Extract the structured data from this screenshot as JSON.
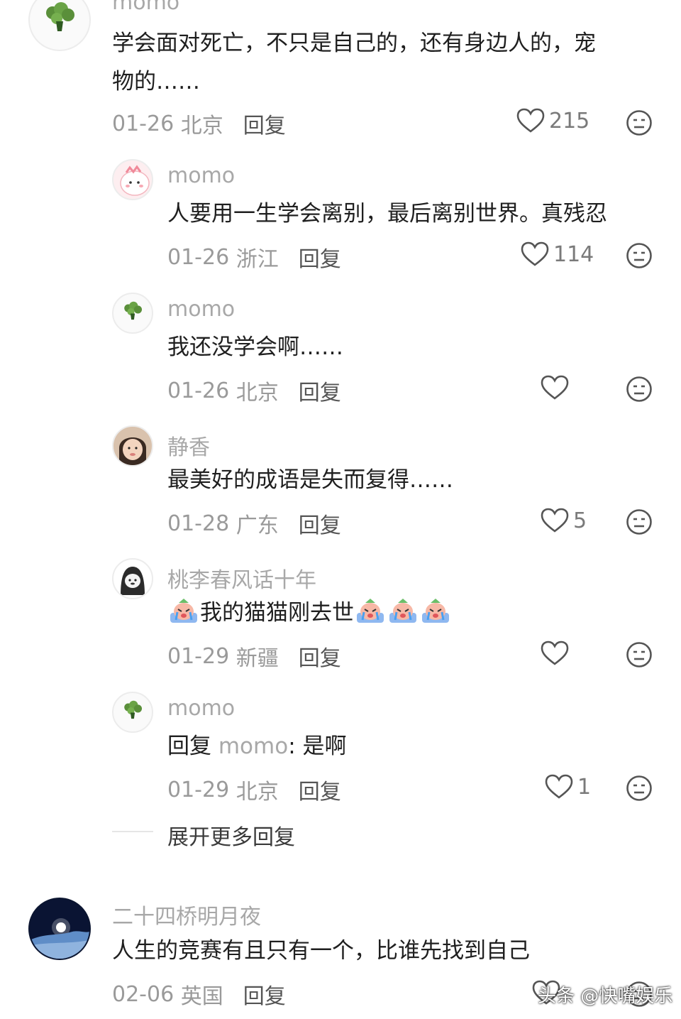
{
  "comments": [
    {
      "name": "momo",
      "text_line1": "学会面对死亡，不只是自己的，还有身边人的，宠",
      "text_line2": "物的……",
      "date": "01-26",
      "location": "北京",
      "reply": "回复",
      "likes": "215",
      "avatar": "broccoli-avatar"
    },
    {
      "name": "momo",
      "text": "人要用一生学会离别，最后离别世界。真残忍",
      "date": "01-26",
      "location": "浙江",
      "reply": "回复",
      "likes": "114",
      "avatar": "pink-cartoon-avatar"
    },
    {
      "name": "momo",
      "text": "我还没学会啊……",
      "date": "01-26",
      "location": "北京",
      "reply": "回复",
      "likes": "",
      "avatar": "broccoli-avatar"
    },
    {
      "name": "静香",
      "text": "最美好的成语是失而复得……",
      "date": "01-28",
      "location": "广东",
      "reply": "回复",
      "likes": "5",
      "avatar": "child-photo-avatar"
    },
    {
      "name": "桃李春风话十年",
      "text": "我的猫猫刚去世",
      "date": "01-29",
      "location": "新疆",
      "reply": "回复",
      "likes": "",
      "avatar": "dark-cartoon-avatar",
      "emoji": "crying-emoji"
    },
    {
      "name": "momo",
      "text_prefix": "回复",
      "text_mention": "momo",
      "text_body": ": 是啊",
      "date": "01-29",
      "location": "北京",
      "reply": "回复",
      "likes": "1",
      "avatar": "broccoli-avatar"
    },
    {
      "name": "二十四桥明月夜",
      "text": "人生的竞赛有且只有一个，比谁先找到自己",
      "date": "02-06",
      "location": "英国",
      "reply": "回复",
      "avatar": "moon-avatar"
    }
  ],
  "expand_replies": "展开更多回复",
  "watermark": "头条 @快嘴娱乐",
  "colors": {
    "name": "#a8a8a8",
    "text": "#1f1f1f",
    "meta": "#9a9a9a",
    "icon": "#555555"
  }
}
